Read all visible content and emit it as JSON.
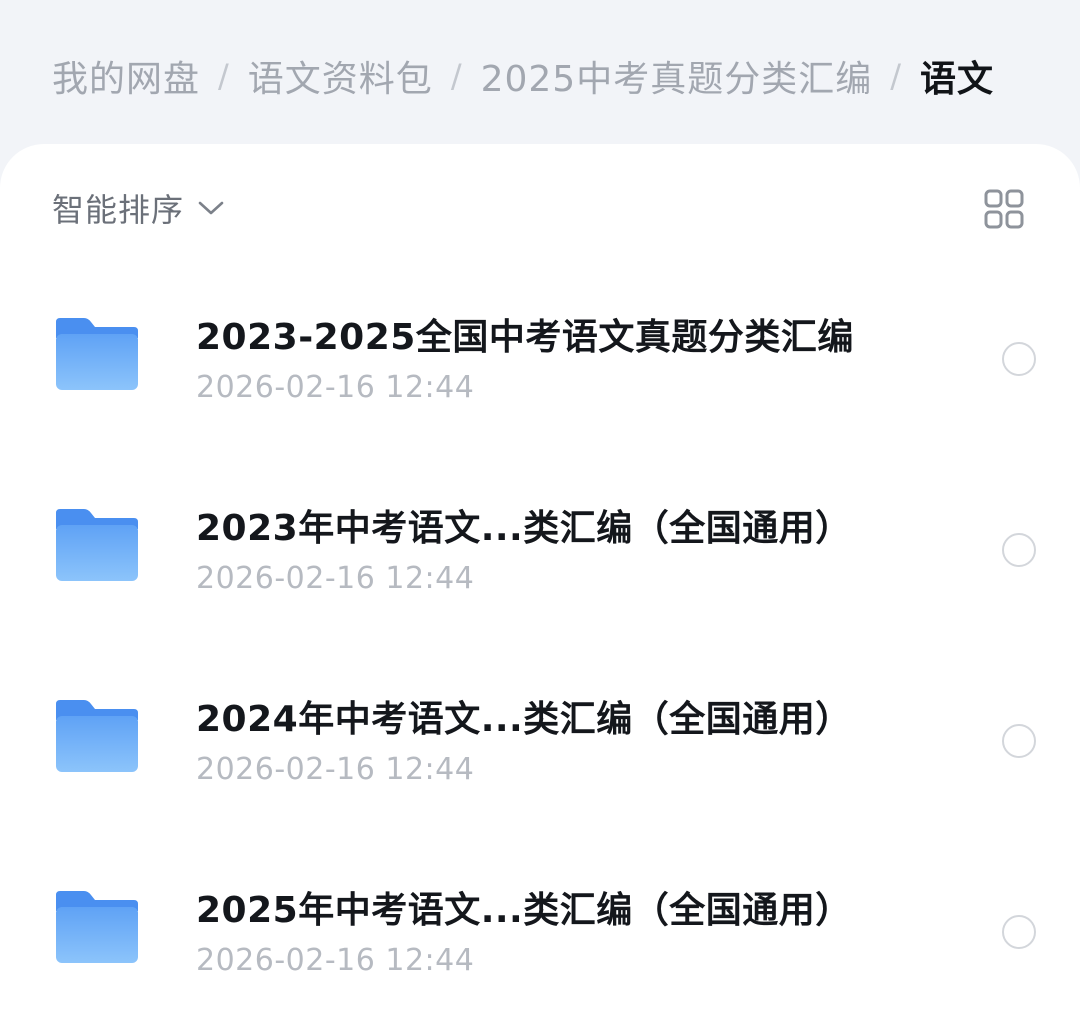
{
  "breadcrumb": {
    "items": [
      "我的网盘",
      "语文资料包",
      "2025中考真题分类汇编",
      "语文"
    ],
    "separator": "/"
  },
  "toolbar": {
    "sort_label": "智能排序",
    "sort_icon": "chevron-down-icon",
    "view_icon": "grid-view-icon"
  },
  "colors": {
    "accent_folder_top": "#4a90f0",
    "accent_folder_bottom": "#8cc4fb",
    "text_primary": "#14171c",
    "text_secondary": "#b6bac1"
  },
  "files": [
    {
      "name": "2023-2025全国中考语文真题分类汇编",
      "date": "2026-02-16 12:44",
      "icon": "folder-icon"
    },
    {
      "name": "2023年中考语文...类汇编（全国通用）",
      "date": "2026-02-16 12:44",
      "icon": "folder-icon"
    },
    {
      "name": "2024年中考语文...类汇编（全国通用）",
      "date": "2026-02-16 12:44",
      "icon": "folder-icon"
    },
    {
      "name": "2025年中考语文...类汇编（全国通用）",
      "date": "2026-02-16 12:44",
      "icon": "folder-icon"
    }
  ]
}
